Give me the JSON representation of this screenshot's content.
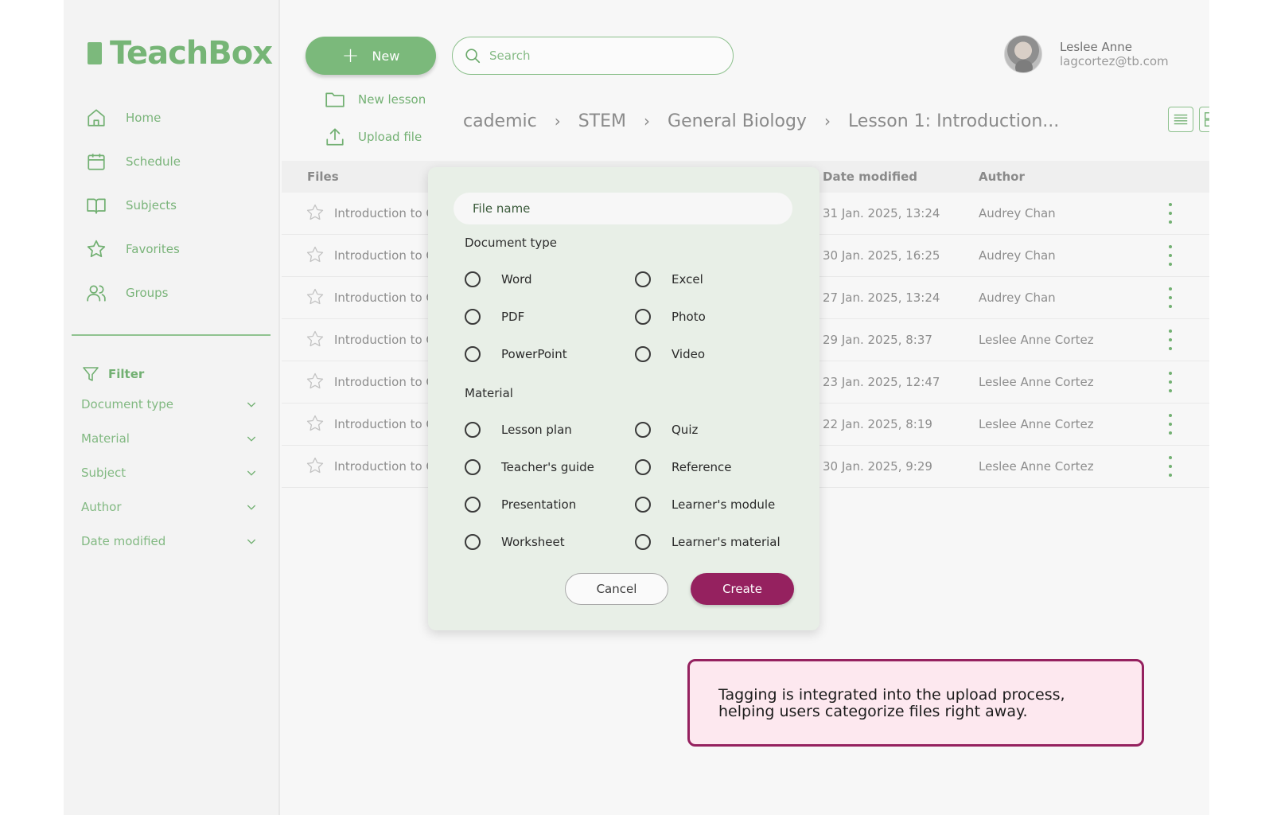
{
  "app": {
    "name": "TeachBox"
  },
  "sidebar": {
    "nav": [
      {
        "label": "Home",
        "icon": "home-icon"
      },
      {
        "label": "Schedule",
        "icon": "calendar-icon"
      },
      {
        "label": "Subjects",
        "icon": "book-icon"
      },
      {
        "label": "Favorites",
        "icon": "star-icon"
      },
      {
        "label": "Groups",
        "icon": "users-icon"
      }
    ],
    "filter": {
      "title": "Filter",
      "items": [
        "Document type",
        "Material",
        "Subject",
        "Author",
        "Date modified"
      ]
    }
  },
  "toolbar": {
    "new_label": "New",
    "search_placeholder": "Search",
    "new_menu": {
      "new_lesson": "New lesson",
      "upload_file": "Upload file"
    }
  },
  "breadcrumb": [
    "cademic",
    "STEM",
    "General Biology",
    "Lesson 1: Introduction..."
  ],
  "user": {
    "name": "Leslee Anne",
    "email": "lagcortez@tb.com"
  },
  "table": {
    "headers": {
      "files": "Files",
      "date_modified": "Date modified",
      "author": "Author"
    },
    "rows": [
      {
        "name": "Introduction to C",
        "date": "31 Jan. 2025, 13:24",
        "author": "Audrey Chan"
      },
      {
        "name": "Introduction to C",
        "date": "30 Jan. 2025, 16:25",
        "author": "Audrey Chan"
      },
      {
        "name": "Introduction to C",
        "date": "27 Jan. 2025, 13:24",
        "author": "Audrey Chan"
      },
      {
        "name": "Introduction to C",
        "date": "29 Jan. 2025, 8:37",
        "author": "Leslee Anne Cortez"
      },
      {
        "name": "Introduction to C",
        "date": "23 Jan. 2025, 12:47",
        "author": "Leslee Anne Cortez"
      },
      {
        "name": "Introduction to C",
        "date": "22 Jan. 2025, 8:19",
        "author": "Leslee Anne Cortez"
      },
      {
        "name": "Introduction to C",
        "date": "30 Jan. 2025, 9:29",
        "author": "Leslee Anne Cortez"
      }
    ]
  },
  "modal": {
    "file_name_placeholder": "File name",
    "document_type_title": "Document type",
    "document_types": [
      "Word",
      "Excel",
      "PDF",
      "Photo",
      "PowerPoint",
      "Video"
    ],
    "material_title": "Material",
    "materials": [
      "Lesson plan",
      "Quiz",
      "Teacher's guide",
      "Reference",
      "Presentation",
      "Learner's module",
      "Worksheet",
      "Learner's material"
    ],
    "cancel_label": "Cancel",
    "create_label": "Create"
  },
  "note": {
    "text": "Tagging is integrated into the upload process, helping users categorize files right away."
  },
  "colors": {
    "brand_green": "#7bb97b",
    "accent_magenta": "#95215f",
    "note_bg": "#fde8ef"
  }
}
